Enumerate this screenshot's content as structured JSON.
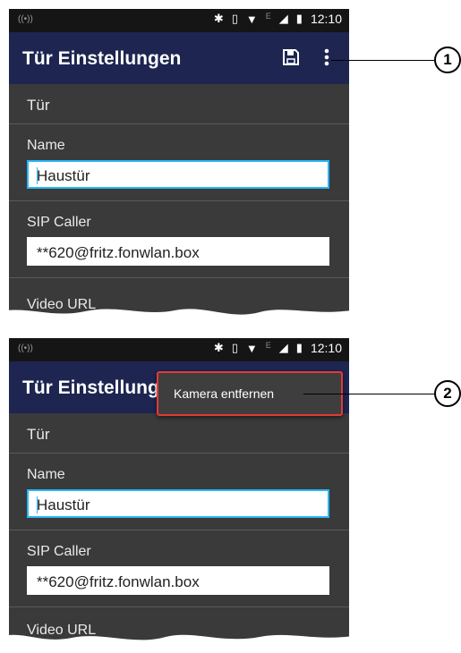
{
  "status_bar": {
    "time": "12:10",
    "network_label": "E"
  },
  "app_bar": {
    "title": "Tür Einstellungen",
    "title_truncated": "Tür Einstellunge",
    "icons": [
      "save-icon",
      "more-vert-icon"
    ]
  },
  "form": {
    "section_title": "Tür",
    "name_label": "Name",
    "name_value": "Haustür",
    "sip_label": "SIP Caller",
    "sip_value": "**620@fritz.fonwlan.box",
    "video_label": "Video URL",
    "video_label_cut": "Video URL"
  },
  "overflow_menu": {
    "items": [
      "Kamera entfernen"
    ]
  },
  "callouts": {
    "first": "1",
    "second": "2"
  },
  "colors": {
    "app_bar": "#1d2550",
    "background": "#3a3a3a",
    "accent": "#29b6f6",
    "highlight": "#e53935"
  }
}
